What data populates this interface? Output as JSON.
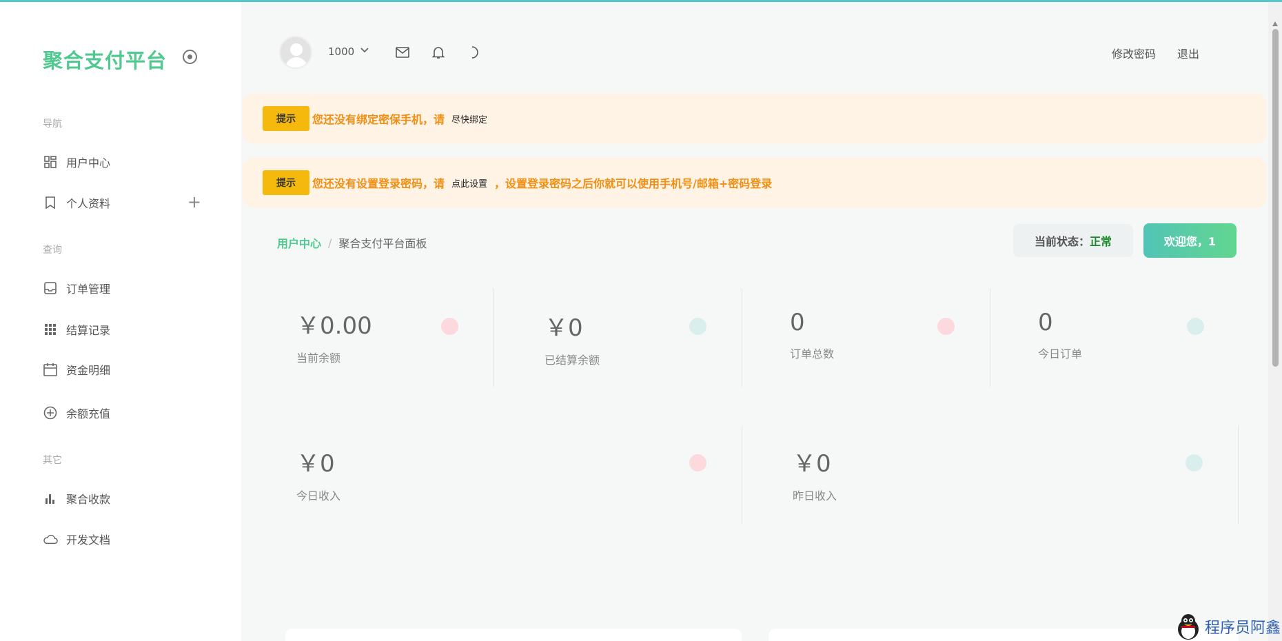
{
  "brand": {
    "name": "聚合支付平台"
  },
  "sidebar": {
    "sections": [
      {
        "title": "导航",
        "items": [
          {
            "label": "用户中心",
            "icon": "dashboard-icon"
          },
          {
            "label": "个人资料",
            "icon": "bookmark-icon",
            "expand": "+"
          }
        ]
      },
      {
        "title": "查询",
        "items": [
          {
            "label": "订单管理",
            "icon": "inbox-icon"
          },
          {
            "label": "结算记录",
            "icon": "grid-icon"
          },
          {
            "label": "资金明细",
            "icon": "calendar-icon"
          },
          {
            "label": "余额充值",
            "icon": "plus-circle-icon"
          }
        ]
      },
      {
        "title": "其它",
        "items": [
          {
            "label": "聚合收款",
            "icon": "bar-chart-icon"
          },
          {
            "label": "开发文档",
            "icon": "cloud-icon"
          }
        ]
      }
    ]
  },
  "header": {
    "user_id": "1000",
    "change_password": "修改密码",
    "logout": "退出"
  },
  "alerts": [
    {
      "tag": "提示",
      "msg": "您还没有绑定密保手机，请",
      "link": "尽快绑定",
      "tail": ""
    },
    {
      "tag": "提示",
      "msg": "您还没有设置登录密码，请",
      "link": "点此设置",
      "tail": "，设置登录密码之后你就可以使用手机号/邮箱+密码登录"
    }
  ],
  "breadcrumb": {
    "home": "用户中心",
    "separator": "/",
    "current": "聚合支付平台面板"
  },
  "status": {
    "label": "当前状态：",
    "value": "正常"
  },
  "welcome": "欢迎您，1",
  "stats_row1": [
    {
      "value": "￥0.00",
      "label": "当前余额"
    },
    {
      "value": "￥0",
      "label": "已结算余额"
    },
    {
      "value": "0",
      "label": "订单总数"
    },
    {
      "value": "0",
      "label": "今日订单"
    }
  ],
  "stats_row2": [
    {
      "value": "￥0",
      "label": "今日收入"
    },
    {
      "value": "￥0",
      "label": "昨日收入"
    }
  ],
  "watermark": "程序员阿鑫",
  "colors": {
    "brand": "#4fc98f",
    "alert_bg": "#fff3e6",
    "alert_text": "#ef8f14",
    "tag": "#f5b90e",
    "status_ok": "#1c8a2c"
  }
}
